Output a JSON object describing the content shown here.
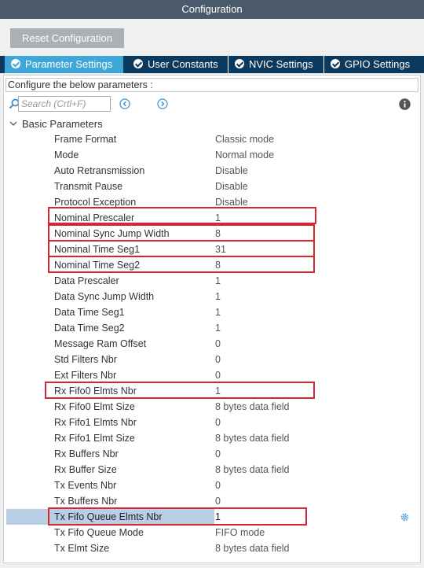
{
  "window": {
    "title": "Configuration"
  },
  "toolbar": {
    "reset_label": "Reset Configuration"
  },
  "tabs": [
    {
      "label": "Parameter Settings",
      "active": true
    },
    {
      "label": "User Constants",
      "active": false
    },
    {
      "label": "NVIC Settings",
      "active": false
    },
    {
      "label": "GPIO Settings",
      "active": false
    }
  ],
  "panel": {
    "hint": "Configure the below parameters :",
    "search_placeholder": "Search (Crtl+F)",
    "group_label": "Basic Parameters"
  },
  "params": [
    {
      "name": "Frame Format",
      "value": "Classic mode"
    },
    {
      "name": "Mode",
      "value": "Normal mode"
    },
    {
      "name": "Auto Retransmission",
      "value": "Disable"
    },
    {
      "name": "Transmit Pause",
      "value": "Disable"
    },
    {
      "name": "Protocol Exception",
      "value": "Disable"
    },
    {
      "name": "Nominal Prescaler",
      "value": "1"
    },
    {
      "name": "Nominal Sync Jump Width",
      "value": "8"
    },
    {
      "name": "Nominal Time Seg1",
      "value": "31"
    },
    {
      "name": "Nominal Time Seg2",
      "value": "8"
    },
    {
      "name": "Data Prescaler",
      "value": "1"
    },
    {
      "name": "Data Sync Jump Width",
      "value": "1"
    },
    {
      "name": "Data Time Seg1",
      "value": "1"
    },
    {
      "name": "Data Time Seg2",
      "value": "1"
    },
    {
      "name": "Message Ram Offset",
      "value": "0"
    },
    {
      "name": "Std Filters Nbr",
      "value": "0"
    },
    {
      "name": "Ext Filters Nbr",
      "value": "0"
    },
    {
      "name": "Rx Fifo0 Elmts Nbr",
      "value": "1"
    },
    {
      "name": "Rx Fifo0 Elmt Size",
      "value": "8 bytes data field"
    },
    {
      "name": "Rx Fifo1 Elmts Nbr",
      "value": "0"
    },
    {
      "name": "Rx Fifo1 Elmt Size",
      "value": "8 bytes data field"
    },
    {
      "name": "Rx Buffers Nbr",
      "value": "0"
    },
    {
      "name": "Rx Buffer Size",
      "value": "8 bytes data field"
    },
    {
      "name": "Tx Events Nbr",
      "value": "0"
    },
    {
      "name": "Tx Buffers Nbr",
      "value": "0"
    },
    {
      "name": "Tx Fifo Queue Elmts Nbr",
      "value": "1",
      "selected": true
    },
    {
      "name": "Tx Fifo Queue Mode",
      "value": "FIFO mode"
    },
    {
      "name": "Tx Elmt Size",
      "value": "8 bytes data field"
    }
  ],
  "colors": {
    "title_bar": "#4b5a6a",
    "tab_bar": "#0b3a5e",
    "tab_active": "#3fa6d8",
    "highlight_box": "#d9252f",
    "selected_row": "#b8cfe6"
  },
  "icons": {
    "search": "search-icon",
    "prev": "arrow-left-circle-icon",
    "next": "arrow-right-circle-icon",
    "info": "info-icon",
    "gear": "gear-icon",
    "collapse": "chevron-down-icon",
    "tab_check": "check-circle-icon"
  }
}
